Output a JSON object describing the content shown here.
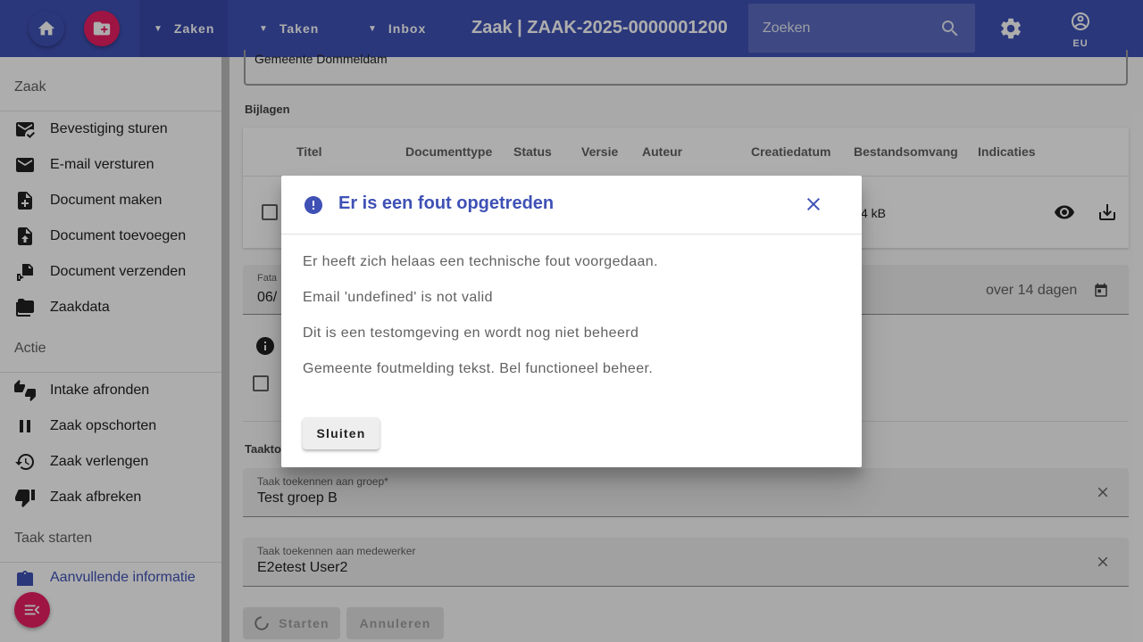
{
  "header": {
    "nav": {
      "zaken": "Zaken",
      "taken": "Taken",
      "inbox": "Inbox"
    },
    "title": "Zaak | ZAAK-2025-0000001200",
    "search_placeholder": "Zoeken",
    "user_initials": "EU",
    "home_icon": "home-icon",
    "new_case_icon": "folder-add-icon",
    "settings_icon": "gear-icon",
    "user_icon": "account-circle-icon"
  },
  "colors": {
    "primary": "#3f51b5",
    "accent": "#e91e63"
  },
  "sidebar": {
    "sections": [
      {
        "title": "Zaak",
        "items": [
          {
            "label": "Bevestiging sturen",
            "icon": "mark-email-read-icon"
          },
          {
            "label": "E-mail versturen",
            "icon": "email-icon"
          },
          {
            "label": "Document maken",
            "icon": "note-add-icon"
          },
          {
            "label": "Document toevoegen",
            "icon": "upload-file-icon"
          },
          {
            "label": "Document verzenden",
            "icon": "send-document-icon"
          },
          {
            "label": "Zaakdata",
            "icon": "folder-icon"
          }
        ]
      },
      {
        "title": "Actie",
        "items": [
          {
            "label": "Intake afronden",
            "icon": "thumbs-up-down-icon"
          },
          {
            "label": "Zaak opschorten",
            "icon": "pause-icon"
          },
          {
            "label": "Zaak verlengen",
            "icon": "history-icon"
          },
          {
            "label": "Zaak afbreken",
            "icon": "thumb-down-icon"
          }
        ]
      },
      {
        "title": "Taak starten",
        "items": [
          {
            "label": "Aanvullende informatie",
            "icon": "clipboard-icon"
          }
        ]
      }
    ]
  },
  "main": {
    "textarea_value": "Gemeente Dommeldam",
    "attachments_label": "Bijlagen",
    "columns": [
      "Titel",
      "Documenttype",
      "Status",
      "Versie",
      "Auteur",
      "Creatiedatum",
      "Bestandsomvang",
      "Indicaties"
    ],
    "row": {
      "size_partial": "4 kB"
    },
    "fatal_label_partial": "Fata",
    "fatal_value_partial": "06/",
    "fatal_relative": "over 14 dagen",
    "task_section_partial": "Taakto",
    "group_field": {
      "label": "Taak toekennen aan groep*",
      "value": "Test groep B"
    },
    "user_field": {
      "label": "Taak toekennen aan medewerker",
      "value": "E2etest User2"
    },
    "start_button": "Starten",
    "cancel_button": "Annuleren"
  },
  "dialog": {
    "title": "Er is een fout opgetreden",
    "lines": [
      "Er heeft zich helaas een technische fout voorgedaan.",
      "Email 'undefined' is not valid",
      "Dit is een testomgeving en wordt nog niet beheerd",
      "Gemeente foutmelding tekst. Bel functioneel beheer."
    ],
    "close_button": "Sluiten"
  }
}
